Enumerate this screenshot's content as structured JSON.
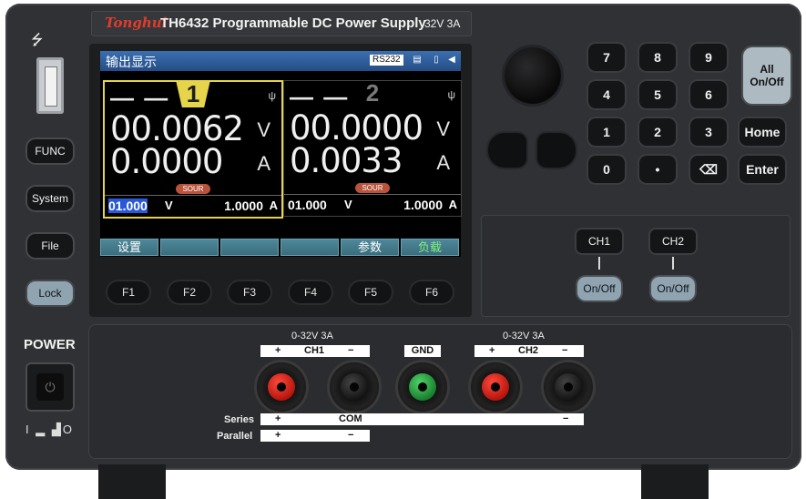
{
  "header": {
    "brand": "Tonghui",
    "model": "TH6432  Programmable DC Power Supply",
    "rating": "32V 3A"
  },
  "usb": {
    "symbol": "⭍"
  },
  "side_buttons": [
    "FUNC",
    "System",
    "File",
    "Lock"
  ],
  "power": {
    "label": "POWER",
    "indicator": "I ▂ ▟O"
  },
  "screen": {
    "title": "输出显示",
    "interface": "RS232",
    "channels": [
      {
        "number": "1",
        "dash": "— —",
        "voltage": "00.0062",
        "current": "0.0000",
        "v_unit": "V",
        "a_unit": "A",
        "mode": "SOUR",
        "set_voltage": "01.000",
        "set_current": "1.0000",
        "set_v_unit": "V",
        "set_a_unit": "A"
      },
      {
        "number": "2",
        "dash": "— —",
        "voltage": "00.0000",
        "current": "0.0033",
        "v_unit": "V",
        "a_unit": "A",
        "mode": "SOUR",
        "set_voltage": "01.000",
        "set_current": "1.0000",
        "set_v_unit": "V",
        "set_a_unit": "A"
      }
    ],
    "softkeys": [
      "设置",
      "",
      "",
      "",
      "参数",
      "负载"
    ]
  },
  "function_keys": [
    "F1",
    "F2",
    "F3",
    "F4",
    "F5",
    "F6"
  ],
  "keypad": {
    "digits": [
      "7",
      "8",
      "9",
      "4",
      "5",
      "6",
      "1",
      "2",
      "3",
      "0",
      "•",
      "⌫"
    ],
    "all_on_off": "All\nOn/Off",
    "home": "Home",
    "enter": "Enter"
  },
  "channel_controls": [
    {
      "label": "CH1",
      "toggle": "On/Off"
    },
    {
      "label": "CH2",
      "toggle": "On/Off"
    }
  ],
  "terminals": {
    "ch1_range": "0-32V  3A",
    "ch2_range": "0-32V  3A",
    "ch1_label": "CH1",
    "ch2_label": "CH2",
    "gnd_label": "GND",
    "plus": "+",
    "minus": "−",
    "series": "Series",
    "parallel": "Parallel",
    "com": "COM"
  }
}
